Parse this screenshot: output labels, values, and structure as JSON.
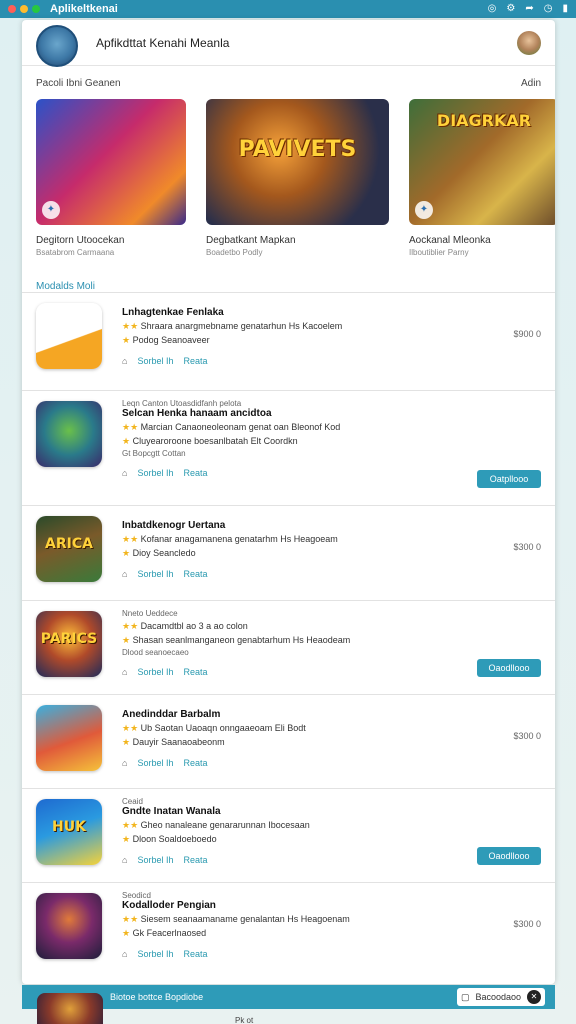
{
  "system": {
    "title": "Aplikeltkenai"
  },
  "header": {
    "title": "Apfikdttat Kenahi Meanla"
  },
  "section": {
    "left": "Pacoli Ibni Geanen",
    "right": "Adin"
  },
  "featured": [
    {
      "title": "Degitorn Utoocekan",
      "sub": "Bsatabrom Carmaana",
      "overlay": ""
    },
    {
      "title": "Degbatkant Mapkan",
      "sub": "Boadetbo Podly",
      "overlay": "PAVIVETS"
    },
    {
      "title": "Aockanal Mleonka",
      "sub": "Ilboutiblier Parny",
      "overlay": "DIAGRKAR"
    }
  ],
  "list_heading": "Modalds Moli",
  "items": [
    {
      "pre": "",
      "title": "Lnhagtenkae Fenlaka",
      "desc": "Shraara anargmebname genatarhun Hs Kacoelem",
      "desc2": "Podog Seanoaveer",
      "desc3": "",
      "price": "$900 0",
      "button": "",
      "icon_text": ""
    },
    {
      "pre": "Leqn Canton Utoasdidfanh pelota",
      "title": "Selcan Henka hanaam ancidtoa",
      "desc": "Marcian Canaoneoleonam genat oan Bleonof Kod",
      "desc2": "Cluyearoroone boesanlbatah Elt Coordkn",
      "desc3": "Gt Bopcgtt Cottan",
      "price": "",
      "button": "Oatpllooo",
      "icon_text": ""
    },
    {
      "pre": "",
      "title": "Inbatdkenogr Uertana",
      "desc": "Kofanar anagamanena genatarhm Hs Heagoeam",
      "desc2": "Dioy Seancledo",
      "desc3": "",
      "price": "$300 0",
      "button": "",
      "icon_text": "ARICA"
    },
    {
      "pre": "Nneto Ueddece",
      "title": "",
      "desc": "Dacamdtbl ao 3 a ao colon",
      "desc2": "Shasan seanlmanganeon genabtarhum Hs Heaodeam",
      "desc3": "Dlood seanoecaeo",
      "price": "",
      "button": "Oaodllooo",
      "icon_text": "PARICS"
    },
    {
      "pre": "",
      "title": "Anedinddar Barbalm",
      "desc": "Ub Saotan Uaoaqn onngaaeoam Eli Bodt",
      "desc2": "Dauyir Saanaoabeonm",
      "desc3": "",
      "price": "$300 0",
      "button": "",
      "icon_text": ""
    },
    {
      "pre": "Ceaid",
      "title": "Gndte Inatan Wanala",
      "desc": "Gheo nanaleane genararunnan Ibocesaan",
      "desc2": "Dloon Soaldoeboedo",
      "desc3": "",
      "price": "",
      "button": "Oaodllooo",
      "icon_text": "HUK"
    },
    {
      "pre": "Seodicd",
      "title": "Kodalloder Pengian",
      "desc": "Siesem seanaamaname genalantan Hs Heagoenam",
      "desc2": "Gk Feacerlnaosed",
      "desc3": "",
      "price": "$300 0",
      "button": "",
      "icon_text": ""
    }
  ],
  "tag_labels": {
    "left": "Sorbel Ih",
    "right": "Reata"
  },
  "bottom_bar": {
    "text": "Biotoe bottce Bopdiobe",
    "chip": "Bacoodaoo"
  },
  "footer": {
    "text": "Pk ot"
  },
  "colors": {
    "accent": "#2e9bb8",
    "topbar": "#2a8fb0",
    "star": "#f2b51e"
  }
}
